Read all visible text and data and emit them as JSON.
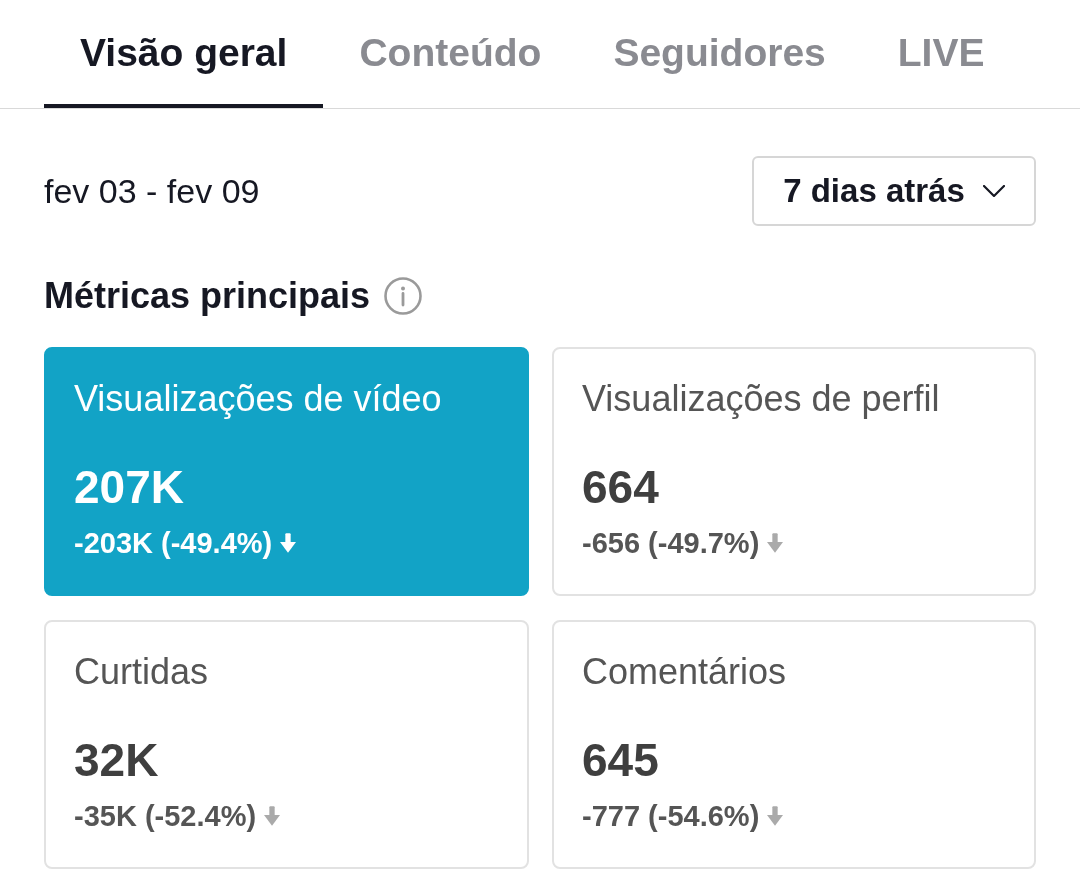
{
  "tabs": [
    {
      "label": "Visão geral",
      "selected": true
    },
    {
      "label": "Conteúdo",
      "selected": false
    },
    {
      "label": "Seguidores",
      "selected": false
    },
    {
      "label": "LIVE",
      "selected": false
    }
  ],
  "date_range": "fev 03 - fev 09",
  "period_dropdown": {
    "value": "7 dias atrás"
  },
  "section": {
    "title": "Métricas principais"
  },
  "metrics": [
    {
      "label": "Visualizações de vídeo",
      "value": "207K",
      "change": "-203K (-49.4%)",
      "decrease": true,
      "selected": true
    },
    {
      "label": "Visualizações de perfil",
      "value": "664",
      "change": "-656 (-49.7%)",
      "decrease": true,
      "selected": false
    },
    {
      "label": "Curtidas",
      "value": "32K",
      "change": "-35K (-52.4%)",
      "decrease": true,
      "selected": false
    },
    {
      "label": "Comentários",
      "value": "645",
      "change": "-777 (-54.6%)",
      "decrease": true,
      "selected": false
    }
  ]
}
